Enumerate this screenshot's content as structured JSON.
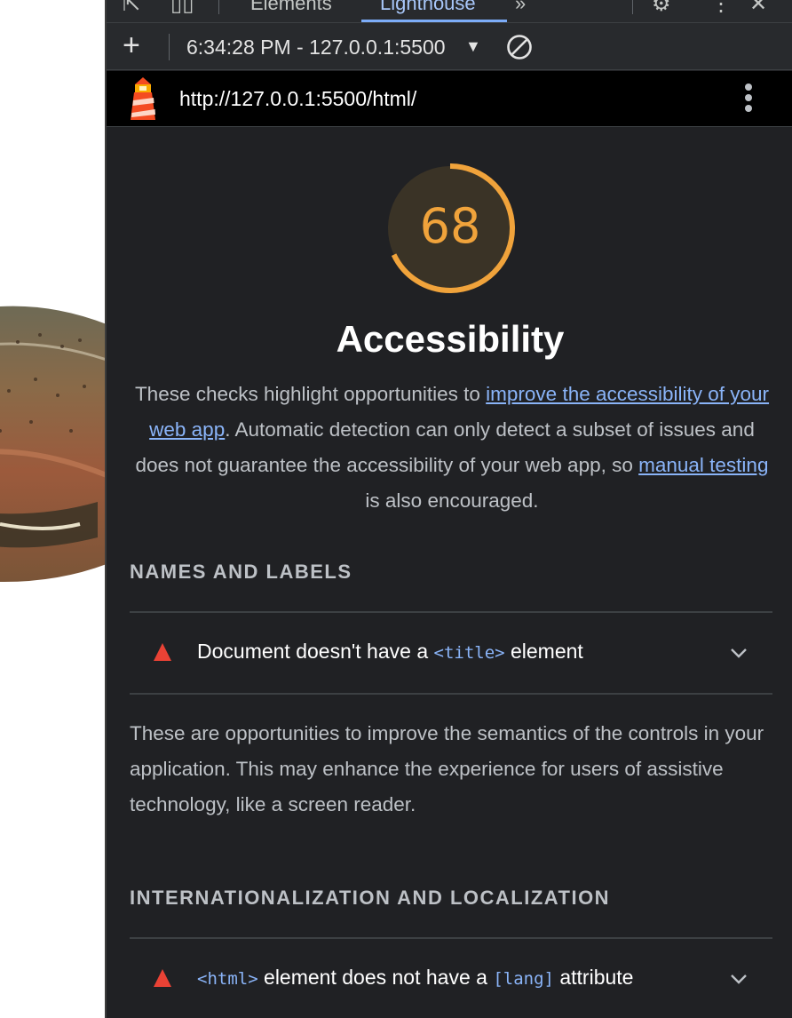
{
  "tabs": {
    "elements": "Elements",
    "lighthouse": "Lighthouse",
    "more": "»"
  },
  "toolbar": {
    "add_label": "+",
    "report_label": "6:34:28 PM - 127.0.0.1:5500",
    "caret": "▼"
  },
  "urlbar": {
    "url": "http://127.0.0.1:5500/html/"
  },
  "category": {
    "score": "68",
    "score_fraction": 0.68,
    "title": "Accessibility",
    "desc_before": "These checks highlight opportunities to ",
    "desc_link1": "improve the accessibility of your web app",
    "desc_mid": ". Automatic detection can only detect a subset of issues and does not guarantee the accessibility of your web app, so ",
    "desc_link2": "manual testing",
    "desc_after": " is also encouraged."
  },
  "groups": [
    {
      "title": "NAMES AND LABELS",
      "audit": {
        "before": "Document doesn't have a ",
        "code1": "<title>",
        "after": " element"
      },
      "description": "These are opportunities to improve the semantics of the controls in your application. This may enhance the experience for users of assistive technology, like a screen reader."
    },
    {
      "title": "INTERNATIONALIZATION AND LOCALIZATION",
      "audit": {
        "code1": "<html>",
        "mid": " element does not have a ",
        "code2": "[lang]",
        "after": " attribute"
      }
    }
  ],
  "colors": {
    "score": "#f0a33b",
    "link": "#8ab4f8",
    "fail": "#e94235",
    "panel_bg": "#202124"
  }
}
